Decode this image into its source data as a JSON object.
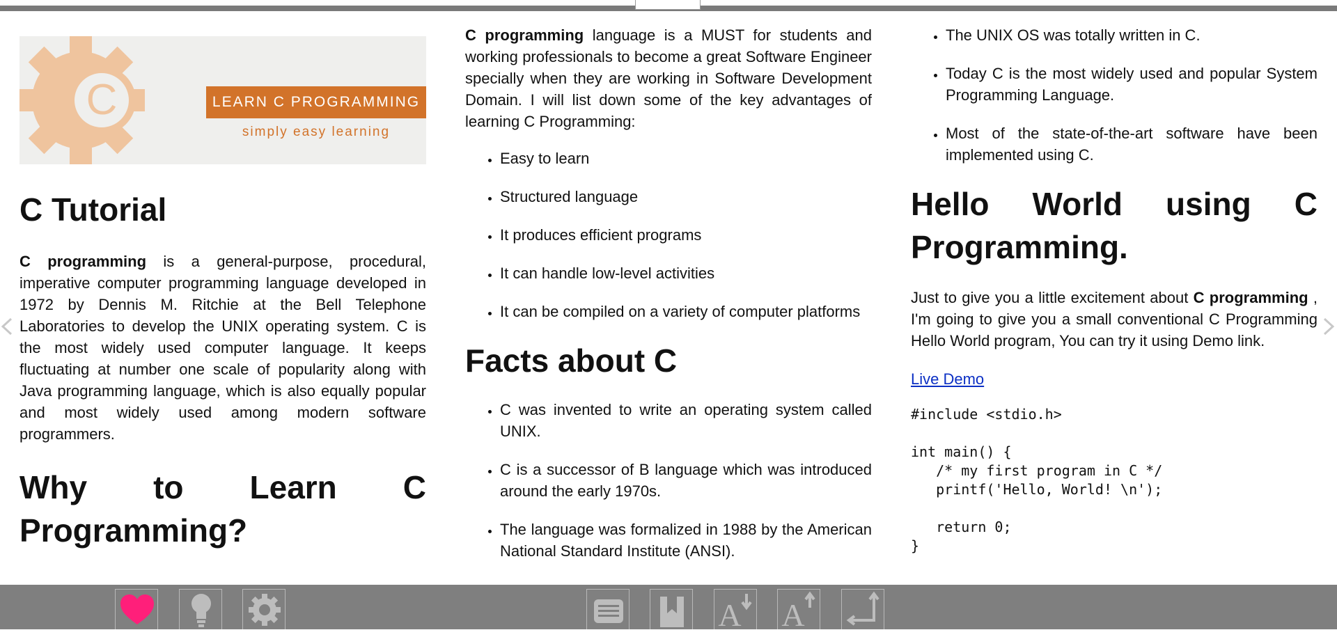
{
  "columns": {
    "col1": {
      "banner": {
        "brand": "LEARN C PROGRAMMING",
        "tagline": "simply easy learning",
        "logo_letter": "C"
      },
      "title": "C Tutorial",
      "intro": {
        "bold": "C programming",
        "text": " is a general-purpose, procedural, imperative computer programming language developed in 1972 by Dennis M. Ritchie at the Bell Telephone Laboratories to develop the UNIX operating system. C is the most widely used computer language. It keeps fluctuating at number one scale of popularity along with Java programming language, which is also equally popular and most widely used among modern software programmers."
      },
      "why_heading": "Why to Learn C Programming?"
    },
    "col2": {
      "para": {
        "bold": "C programming",
        "text": " language is a MUST for students and working professionals to become a great Software Engineer specially when they are working in Software Development Domain. I will list down some of the key advantages of learning C Programming:"
      },
      "advantages": [
        "Easy to learn",
        "Structured language",
        "It produces efficient programs",
        "It can handle low-level activities",
        "It can be compiled on a variety of computer platforms"
      ],
      "facts_heading": "Facts about C",
      "facts": [
        "C was invented to write an operating system called UNIX.",
        "C is a successor of B language which was introduced around the early 1970s.",
        "The language was formalized in 1988 by the American National Standard Institute (ANSI)."
      ]
    },
    "col3": {
      "facts_cont": [
        "The UNIX OS was totally written in C.",
        "Today C is the most widely used and popular System Programming Language.",
        "Most of the state-of-the-art software have been implemented using C."
      ],
      "hello_heading": "Hello World using C Programming.",
      "hello_para": {
        "text1": "Just to give you a little excitement about ",
        "bold": "C programming",
        "text2": " , I'm going to give you a small conventional C Programming Hello World program, You can try it using Demo link."
      },
      "demo_link": "Live Demo",
      "code": "#include <stdio.h>\n\nint main() {\n   /* my first program in C */\n   printf('Hello, World! \\n');\n   \n   return 0;\n}"
    }
  },
  "toolbar": {
    "buttons": [
      {
        "name": "favorite-button",
        "icon": "heart-icon"
      },
      {
        "name": "tips-button",
        "icon": "lightbulb-icon"
      },
      {
        "name": "settings-button",
        "icon": "gear-icon"
      },
      {
        "name": "contents-button",
        "icon": "list-icon"
      },
      {
        "name": "bookmark-button",
        "icon": "bookmark-icon"
      },
      {
        "name": "decrease-font-button",
        "icon": "font-decrease-icon"
      },
      {
        "name": "increase-font-button",
        "icon": "font-increase-icon"
      },
      {
        "name": "layout-button",
        "icon": "axes-icon"
      }
    ]
  },
  "colors": {
    "accent": "#d2732a",
    "heart": "#ff1f7a",
    "toolbar": "#7f7f7f",
    "link": "#0b2fc4"
  }
}
